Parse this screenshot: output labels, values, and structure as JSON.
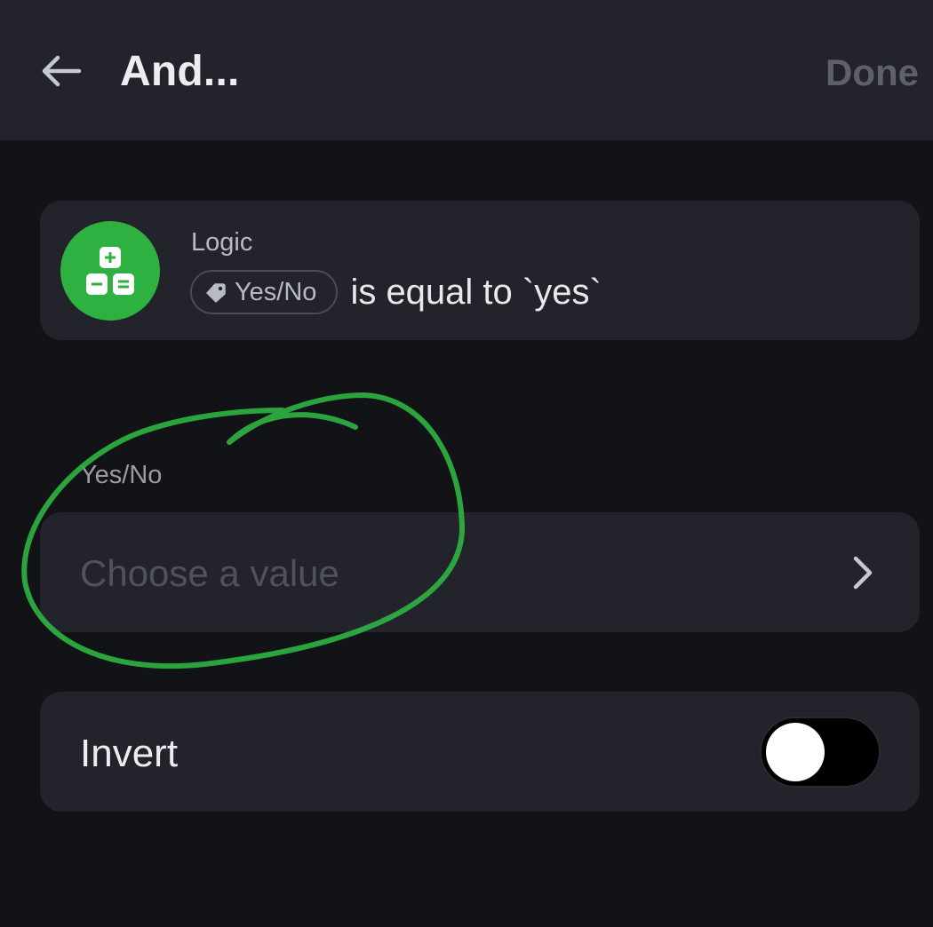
{
  "header": {
    "title": "And...",
    "done_label": "Done"
  },
  "logic_card": {
    "category": "Logic",
    "chip_label": "Yes/No",
    "condition": "is equal to `yes`",
    "icon_color": "#2fb142"
  },
  "value_field": {
    "label": "Yes/No",
    "placeholder": "Choose a value"
  },
  "invert": {
    "label": "Invert",
    "enabled": false
  },
  "annotation": {
    "color": "#2fb142",
    "shape": "hand-drawn-circle"
  }
}
